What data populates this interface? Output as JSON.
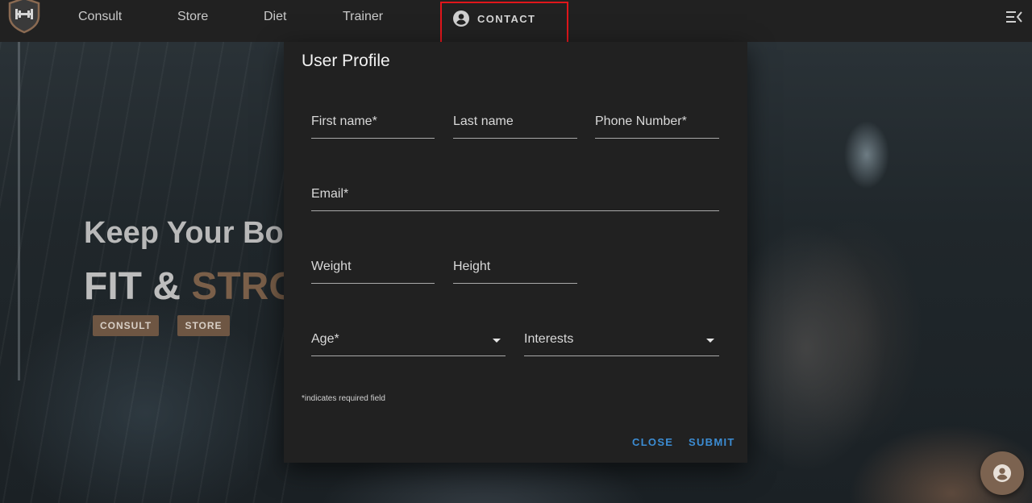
{
  "navbar": {
    "logo": "dumbbell-shield-logo",
    "items": [
      {
        "label": "Consult"
      },
      {
        "label": "Store"
      },
      {
        "label": "Diet"
      },
      {
        "label": "Trainer"
      }
    ],
    "contact_label": "CONTACT",
    "highlight_color": "#e0161b"
  },
  "hero": {
    "heading": "Keep Your Bod",
    "fit": "FIT &",
    "accent": "STRO",
    "buttons": {
      "consult": "CONSULT",
      "store": "STORE"
    },
    "accent_color": "#7a5f49"
  },
  "modal": {
    "title": "User Profile",
    "fields": {
      "first_name": "First name*",
      "last_name": "Last name",
      "phone": "Phone Number*",
      "email": "Email*",
      "weight": "Weight",
      "height": "Height",
      "age": "Age*",
      "interests": "Interests"
    },
    "required_note": "*indicates required field",
    "actions": {
      "close": "CLOSE",
      "submit": "SUBMIT"
    },
    "action_color": "#3c8dd4"
  }
}
